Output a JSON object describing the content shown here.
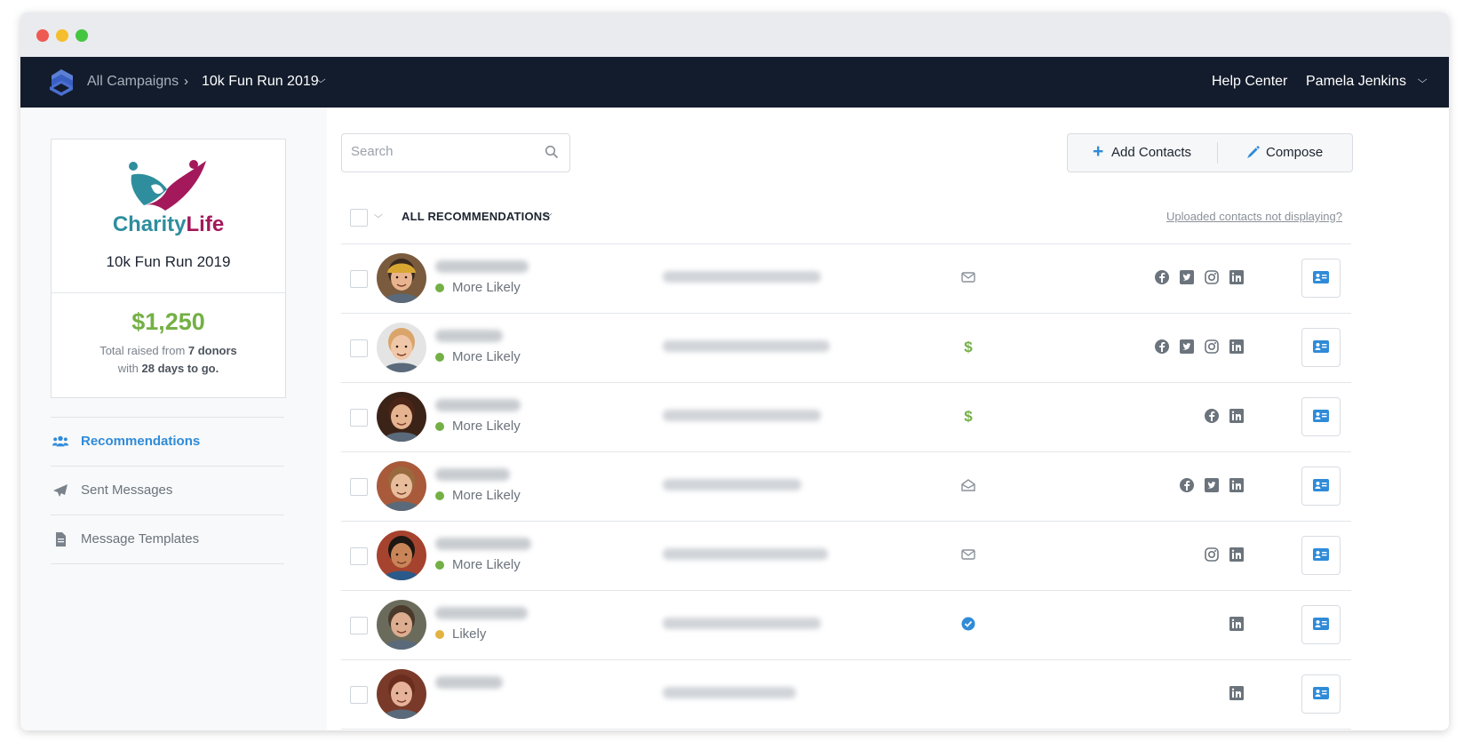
{
  "window": {
    "controls": [
      "close",
      "minimize",
      "maximize"
    ]
  },
  "nav": {
    "crumb_all": "All Campaigns",
    "crumb_current": "10k Fun Run 2019",
    "help": "Help Center",
    "user": "Pamela Jenkins"
  },
  "campaign": {
    "brand_1": "Charity",
    "brand_2": "Life",
    "name": "10k Fun Run 2019",
    "amount": "$1,250",
    "raised_prefix": "Total raised from ",
    "donors": "7 donors",
    "with": "with ",
    "days": "28 days to go."
  },
  "sidebar": {
    "items": [
      {
        "label": "Recommendations",
        "icon": "users-icon"
      },
      {
        "label": "Sent Messages",
        "icon": "paper-plane-icon"
      },
      {
        "label": "Message Templates",
        "icon": "document-icon"
      }
    ]
  },
  "toolbar": {
    "search_placeholder": "Search",
    "add_contacts": "Add Contacts",
    "compose": "Compose"
  },
  "filter": {
    "label": "ALL RECOMMENDATIONS",
    "link": "Uploaded contacts not displaying?"
  },
  "colors": {
    "accent": "#2f8bd8",
    "nav_bg": "#131c2c",
    "money_green": "#74b045",
    "more_likely": "#74b045",
    "likely": "#e3b341"
  },
  "contacts": [
    {
      "likelihood": "More Likely",
      "status": "envelope-icon",
      "socials": [
        "facebook-icon",
        "twitter-icon",
        "instagram-icon",
        "linkedin-icon"
      ]
    },
    {
      "likelihood": "More Likely",
      "status": "dollar-icon",
      "socials": [
        "facebook-icon",
        "twitter-icon",
        "instagram-icon",
        "linkedin-icon"
      ]
    },
    {
      "likelihood": "More Likely",
      "status": "dollar-icon",
      "socials": [
        "facebook-icon",
        "linkedin-icon"
      ]
    },
    {
      "likelihood": "More Likely",
      "status": "envelope-open-icon",
      "socials": [
        "facebook-icon",
        "twitter-icon",
        "linkedin-icon"
      ]
    },
    {
      "likelihood": "More Likely",
      "status": "envelope-icon",
      "socials": [
        "instagram-icon",
        "linkedin-icon"
      ]
    },
    {
      "likelihood": "Likely",
      "status": "check-circle-icon",
      "socials": [
        "linkedin-icon"
      ]
    },
    {
      "likelihood": "",
      "status": "",
      "socials": [
        "linkedin-icon"
      ]
    }
  ]
}
